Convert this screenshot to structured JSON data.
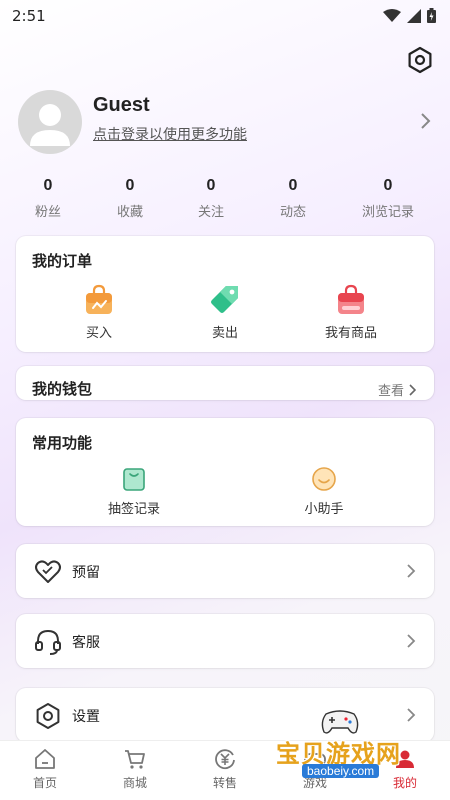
{
  "status": {
    "time": "2:51"
  },
  "profile": {
    "name": "Guest",
    "login_hint": "点击登录以使用更多功能"
  },
  "stats": [
    {
      "value": "0",
      "label": "粉丝"
    },
    {
      "value": "0",
      "label": "收藏"
    },
    {
      "value": "0",
      "label": "关注"
    },
    {
      "value": "0",
      "label": "动态"
    },
    {
      "value": "0",
      "label": "浏览记录"
    }
  ],
  "orders": {
    "title": "我的订单",
    "items": [
      {
        "label": "买入",
        "icon": "buy-bag-icon"
      },
      {
        "label": "卖出",
        "icon": "sell-tag-icon"
      },
      {
        "label": "我有商品",
        "icon": "my-goods-bag-icon"
      }
    ]
  },
  "wallet": {
    "title": "我的钱包",
    "view_label": "查看"
  },
  "common": {
    "title": "常用功能",
    "items": [
      {
        "label": "抽签记录",
        "icon": "lottery-bag-icon"
      },
      {
        "label": "小助手",
        "icon": "assistant-face-icon"
      }
    ]
  },
  "rows": [
    {
      "label": "预留",
      "icon": "heart-icon"
    },
    {
      "label": "客服",
      "icon": "headset-icon"
    },
    {
      "label": "设置",
      "icon": "settings-hex-icon"
    }
  ],
  "nav": [
    {
      "label": "首页",
      "icon": "home-icon"
    },
    {
      "label": "商城",
      "icon": "cart-icon"
    },
    {
      "label": "转售",
      "icon": "resale-icon"
    },
    {
      "label": "游戏",
      "icon": "game-icon"
    },
    {
      "label": "我的",
      "icon": "profile-icon",
      "active": true
    }
  ],
  "watermark": {
    "text": "宝贝游戏网",
    "url": "baobeiy.com"
  },
  "colors": {
    "accent": "#d82a35",
    "order_buy": "#f39a3b",
    "order_sell": "#2fbf8a",
    "order_goods": "#e8454f"
  }
}
